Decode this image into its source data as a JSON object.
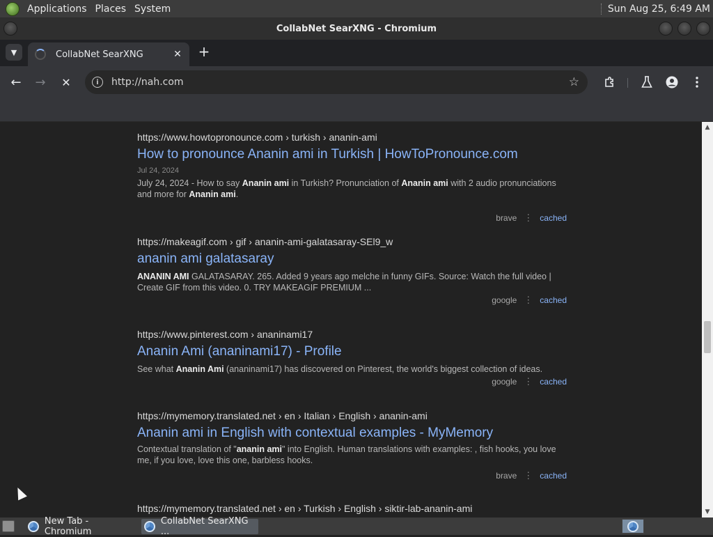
{
  "top_panel": {
    "menus": [
      "Applications",
      "Places",
      "System"
    ],
    "clock": "Sun Aug 25,  6:49 AM"
  },
  "window": {
    "title": "CollabNet SearXNG - Chromium"
  },
  "tabs": [
    {
      "title": "CollabNet SearXNG",
      "close": "✕"
    }
  ],
  "new_tab_label": "+",
  "toolbar": {
    "back": "←",
    "forward": "→",
    "stop": "✕",
    "url": "http://nah.com",
    "bookmark_star": "☆"
  },
  "results": [
    {
      "url": "https://www.howtopronounce.com",
      "path": " › turkish › ananin-ami",
      "title": "How to pronounce Ananin ami in Turkish | HowToPronounce.com",
      "date": "Jul 24, 2024",
      "content": [
        {
          "t": "July 24, 2024 - How to say ",
          "b": false
        },
        {
          "t": "Ananin ami",
          "b": true
        },
        {
          "t": " in Turkish? Pronunciation of ",
          "b": false
        },
        {
          "t": "Ananin ami",
          "b": true
        },
        {
          "t": " with 2 audio pronunciations and more for ",
          "b": false
        },
        {
          "t": "Ananin ami",
          "b": true
        },
        {
          "t": ".",
          "b": false
        }
      ],
      "engine": "brave",
      "cached": "cached"
    },
    {
      "url": "https://makeagif.com",
      "path": " › gif › ananin-ami-galatasaray-SEl9_w",
      "title": "ananin ami galatasaray",
      "date": "",
      "content": [
        {
          "t": "ANANIN AMI",
          "b": true
        },
        {
          "t": " GALATASARAY. 265. Added 9 years ago melche in funny GIFs. Source: Watch the full video | Create GIF from this video. 0. TRY MAKEAGIF PREMIUM ...",
          "b": false
        }
      ],
      "engine": "google",
      "cached": "cached"
    },
    {
      "url": "https://www.pinterest.com",
      "path": " › ananinami17",
      "title": "Ananin Ami (ananinami17) - Profile",
      "date": "",
      "content": [
        {
          "t": "See what ",
          "b": false
        },
        {
          "t": "Ananin Ami",
          "b": true
        },
        {
          "t": " (ananinami17) has discovered on Pinterest, the world's biggest collection of ideas.",
          "b": false
        }
      ],
      "engine": "google",
      "cached": "cached"
    },
    {
      "url": "https://mymemory.translated.net",
      "path": " › en › Italian › English › ananin-ami",
      "title": "Ananin ami in English with contextual examples - MyMemory",
      "date": "",
      "content": [
        {
          "t": "Contextual translation of \"",
          "b": false
        },
        {
          "t": "ananin ami",
          "b": true
        },
        {
          "t": "\" into English. Human translations with examples: , fish hooks, you love me, if you love, love this one, barbless hooks.",
          "b": false
        }
      ],
      "engine": "brave",
      "cached": "cached"
    },
    {
      "url": "https://mymemory.translated.net",
      "path": " › en › Turkish › English › siktir-lab-ananin-ami",
      "title": "",
      "date": "",
      "content": [],
      "engine": "",
      "cached": ""
    }
  ],
  "meta_separator": "⋮",
  "taskbar": {
    "tasks": [
      "New Tab - Chromium",
      "CollabNet SearXNG ..."
    ]
  }
}
